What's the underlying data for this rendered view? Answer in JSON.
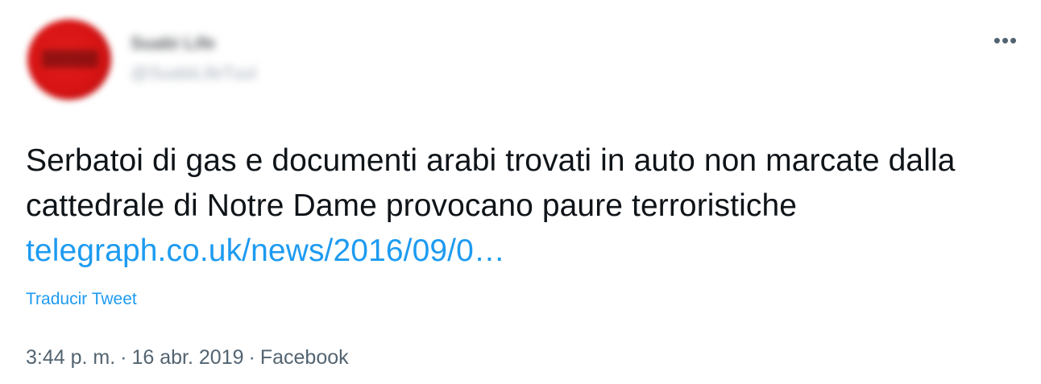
{
  "tweet": {
    "author": {
      "display_name": "Suabi Life",
      "handle": "@SuabiLifeTuul"
    },
    "more_icon": "more-horizontal-icon",
    "text_main": "Serbatoi di gas e documenti arabi trovati in auto non marcate dalla cattedrale di Notre Dame provocano paure terroristiche ",
    "link_text": "telegraph.co.uk/news/2016/09/0…",
    "translate_label": "Traducir Tweet",
    "time": "3:44 p. m.",
    "date": "16 abr. 2019",
    "source": "Facebook",
    "separator": "·"
  },
  "colors": {
    "link": "#1d9bf0",
    "text": "#0f1419",
    "muted": "#536471",
    "avatar": "#d81414"
  }
}
